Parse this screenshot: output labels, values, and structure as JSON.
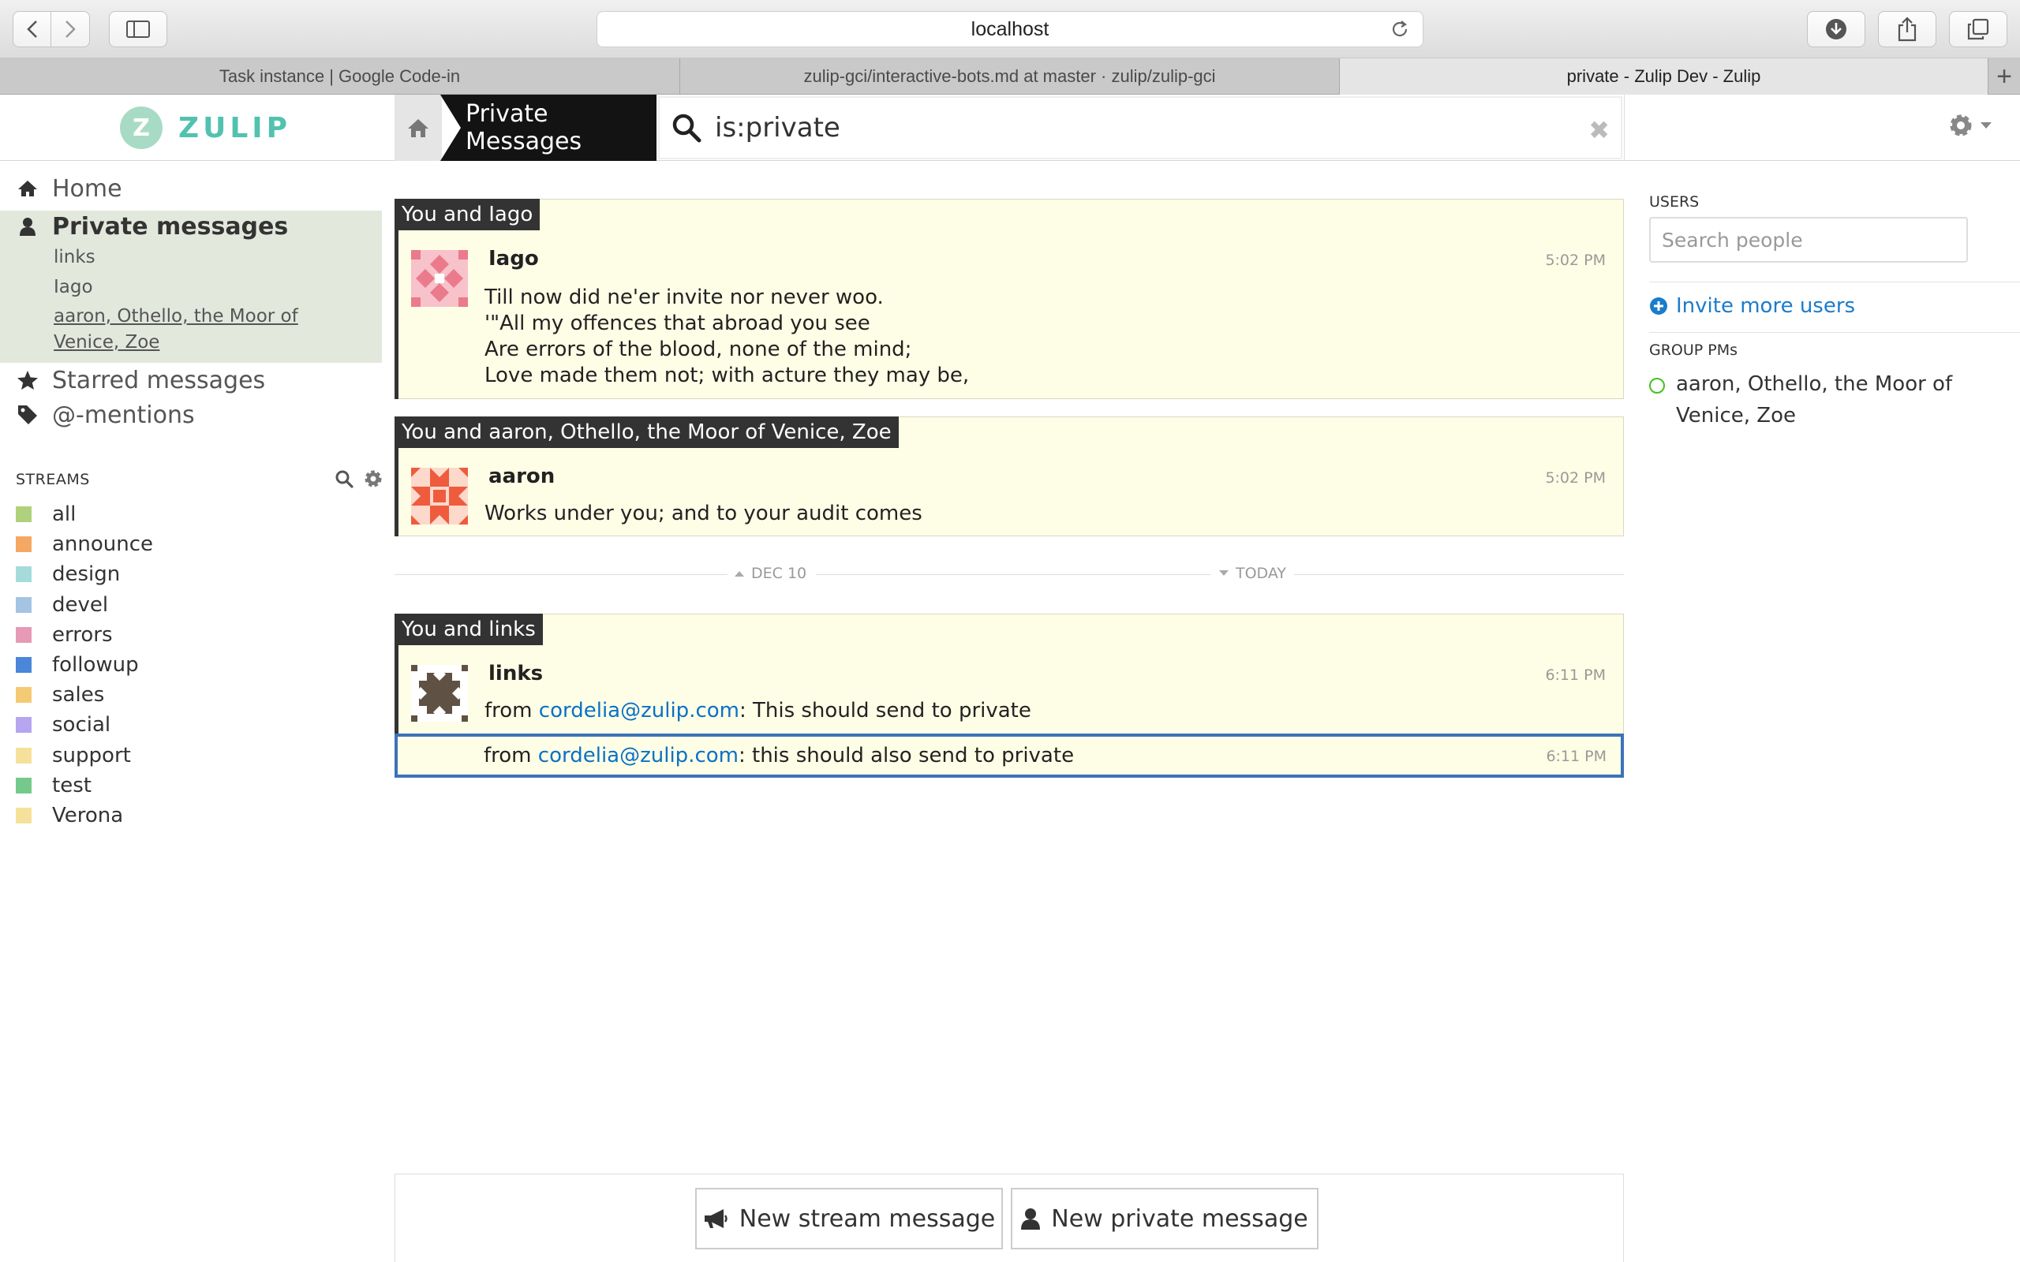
{
  "browser": {
    "address": "localhost",
    "tabs": [
      {
        "label": "Task instance | Google Code-in",
        "active": false
      },
      {
        "label": "zulip-gci/interactive-bots.md at master · zulip/zulip-gci",
        "active": false
      },
      {
        "label": "private - Zulip Dev - Zulip",
        "active": true
      }
    ],
    "new_tab_symbol": "+"
  },
  "brand": {
    "logo_letter": "Z",
    "name": "ZULIP"
  },
  "header": {
    "narrow_label": "Private Messages",
    "search_query": "is:private",
    "clear_symbol": "✖"
  },
  "left_sidebar": {
    "home": "Home",
    "private_messages": "Private messages",
    "pm_conversations": [
      "links",
      "Iago",
      "aaron, Othello, the Moor of Venice, Zoe"
    ],
    "starred": "Starred messages",
    "mentions": "@-mentions",
    "streams_heading": "STREAMS",
    "streams": [
      {
        "name": "all",
        "color": "#b0d17b"
      },
      {
        "name": "announce",
        "color": "#f4a863"
      },
      {
        "name": "design",
        "color": "#a6dbdb"
      },
      {
        "name": "devel",
        "color": "#a5c3e3"
      },
      {
        "name": "errors",
        "color": "#e79ab5"
      },
      {
        "name": "followup",
        "color": "#4a86d9"
      },
      {
        "name": "sales",
        "color": "#f5ca75"
      },
      {
        "name": "social",
        "color": "#b6a5f1"
      },
      {
        "name": "support",
        "color": "#f6e19b"
      },
      {
        "name": "test",
        "color": "#76c98d"
      },
      {
        "name": "Verona",
        "color": "#f6e19b"
      }
    ]
  },
  "messages": {
    "group1": {
      "recipient": "You and Iago",
      "sender": "Iago",
      "time": "5:02 PM",
      "lines": [
        "Till now did ne'er invite nor never woo.",
        "'\"All my offences that abroad you see",
        "Are errors of the blood, none of the mind;",
        "Love made them not; with acture they may be,"
      ]
    },
    "group2": {
      "recipient": "You and aaron, Othello, the Moor of Venice, Zoe",
      "sender": "aaron",
      "time": "5:02 PM",
      "text": "Works under you; and to your audit comes"
    },
    "divider": {
      "left": "DEC 10",
      "right": "TODAY"
    },
    "group3": {
      "recipient": "You and links",
      "sender": "links",
      "msg1": {
        "prefix": "from ",
        "email": "cordelia@zulip.com",
        "suffix": ": This should send to private",
        "time": "6:11 PM"
      },
      "msg2": {
        "prefix": "from ",
        "email": "cordelia@zulip.com",
        "suffix": ": this should also send to private",
        "time": "6:11 PM"
      }
    }
  },
  "right_sidebar": {
    "users_heading": "USERS",
    "search_placeholder": "Search people",
    "invite_label": "Invite more users",
    "group_pms_heading": "GROUP PMs",
    "group_pm": "aaron, Othello, the Moor of Venice, Zoe"
  },
  "compose": {
    "new_stream": "New stream message",
    "new_private": "New private message"
  }
}
